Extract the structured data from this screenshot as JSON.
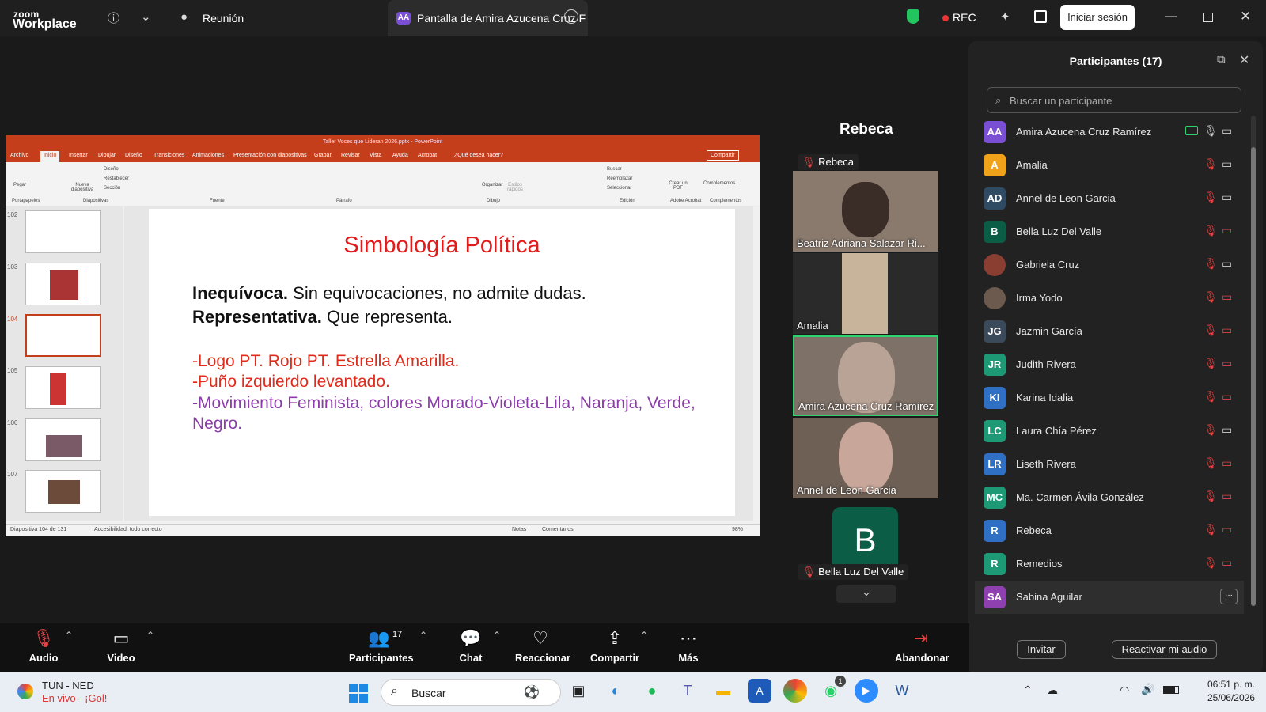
{
  "topbar": {
    "logo_line1": "zoom",
    "logo_line2": "Workplace",
    "meeting_label": "Reunión",
    "tab_avatar": "AA",
    "tab_title": "Pantalla de Amira Azucena Cruz F",
    "rec_label": "REC",
    "signin_label": "Iniciar sesión"
  },
  "powerpoint": {
    "title": "Taller Voces que Lideran 2026.pptx - PowerPoint",
    "menu": [
      "Archivo",
      "Inicio",
      "Insertar",
      "Dibujar",
      "Diseño",
      "Transiciones",
      "Animaciones",
      "Presentación con diapositivas",
      "Grabar",
      "Revisar",
      "Vista",
      "Ayuda",
      "Acrobat",
      "¿Qué desea hacer?"
    ],
    "share_label": "Compartir",
    "ribbon_groups": [
      "Portapapeles",
      "Diapositivas",
      "Fuente",
      "Párrafo",
      "Dibujo",
      "Edición",
      "Adobe Acrobat",
      "Complementos"
    ],
    "ribbon_buttons": [
      "Pegar",
      "Nueva diapositiva",
      "Diseño",
      "Restablecer",
      "Sección",
      "Organizar",
      "Estilos rápidos",
      "Buscar",
      "Reemplazar",
      "Seleccionar",
      "Crear un PDF",
      "Complementos"
    ],
    "thumbnail_numbers": [
      "102",
      "103",
      "104",
      "105",
      "106",
      "107"
    ],
    "slide": {
      "title": "Simbología Política",
      "line1_bold": "Inequívoca.",
      "line1_rest": " Sin equivocaciones, no admite dudas.",
      "line2_bold": "Representativa.",
      "line2_rest": " Que representa.",
      "red_line1": "-Logo PT. Rojo PT. Estrella Amarilla.",
      "red_line2": "-Puño izquierdo levantado.",
      "purple_line": "-Movimiento Feminista, colores Morado-Violeta-Lila, Naranja, Verde, Negro."
    },
    "status_left": "Diapositiva 104 de 131",
    "status_access": "Accesibilidad: todo correcto",
    "status_notes": "Notas",
    "status_comments": "Comentarios",
    "zoom": "98%"
  },
  "gallery": {
    "speaker": "Rebeca",
    "rebeca_label": "Rebeca",
    "tiles": [
      "Beatriz Adriana Salazar Ri...",
      "Amalia",
      "Amira Azucena Cruz Ramírez",
      "Annel de Leon Garcia"
    ],
    "bella_initial": "B",
    "bella_label": "Bella Luz Del Valle"
  },
  "participants": {
    "title": "Participantes (17)",
    "search_placeholder": "Buscar un participante",
    "list": [
      {
        "initials": "AA",
        "name": "Amira Azucena Cruz Ramírez",
        "color": "#7b4fd3"
      },
      {
        "initials": "A",
        "name": "Amalia",
        "color": "#f0a21a"
      },
      {
        "initials": "AD",
        "name": "Annel de Leon Garcia",
        "color": "#2f4a63"
      },
      {
        "initials": "B",
        "name": "Bella Luz Del Valle",
        "color": "#0b5d46"
      },
      {
        "initials": "",
        "name": "Gabriela Cruz",
        "color": "#8a3e32"
      },
      {
        "initials": "",
        "name": "Irma Yodo",
        "color": "#6d5a4e"
      },
      {
        "initials": "JG",
        "name": "Jazmin García",
        "color": "#3b4a5a"
      },
      {
        "initials": "JR",
        "name": "Judith Rivera",
        "color": "#1d9a75"
      },
      {
        "initials": "KI",
        "name": "Karina Idalia",
        "color": "#2f6fc4"
      },
      {
        "initials": "LC",
        "name": "Laura Chía Pérez",
        "color": "#1d9a75"
      },
      {
        "initials": "LR",
        "name": "Liseth Rivera",
        "color": "#2f6fc4"
      },
      {
        "initials": "MC",
        "name": "Ma. Carmen Ávila González",
        "color": "#1d9a75"
      },
      {
        "initials": "R",
        "name": "Rebeca",
        "color": "#2f6fc4"
      },
      {
        "initials": "R",
        "name": "Remedios",
        "color": "#1d9a75"
      },
      {
        "initials": "SA",
        "name": "Sabina Aguilar",
        "color": "#8e3fb0"
      }
    ],
    "invite_label": "Invitar",
    "unmute_label": "Reactivar mi audio"
  },
  "toolbar": {
    "audio": "Audio",
    "video": "Video",
    "participants": "Participantes",
    "participants_count": "17",
    "chat": "Chat",
    "react": "Reaccionar",
    "share": "Compartir",
    "more": "Más",
    "leave": "Abandonar"
  },
  "taskbar": {
    "weather_title": "TUN - NED",
    "weather_sub": "En vivo - ¡Gol!",
    "search_label": "Buscar",
    "badge": "1",
    "time": "06:51 p. m.",
    "date": "25/06/2026"
  }
}
